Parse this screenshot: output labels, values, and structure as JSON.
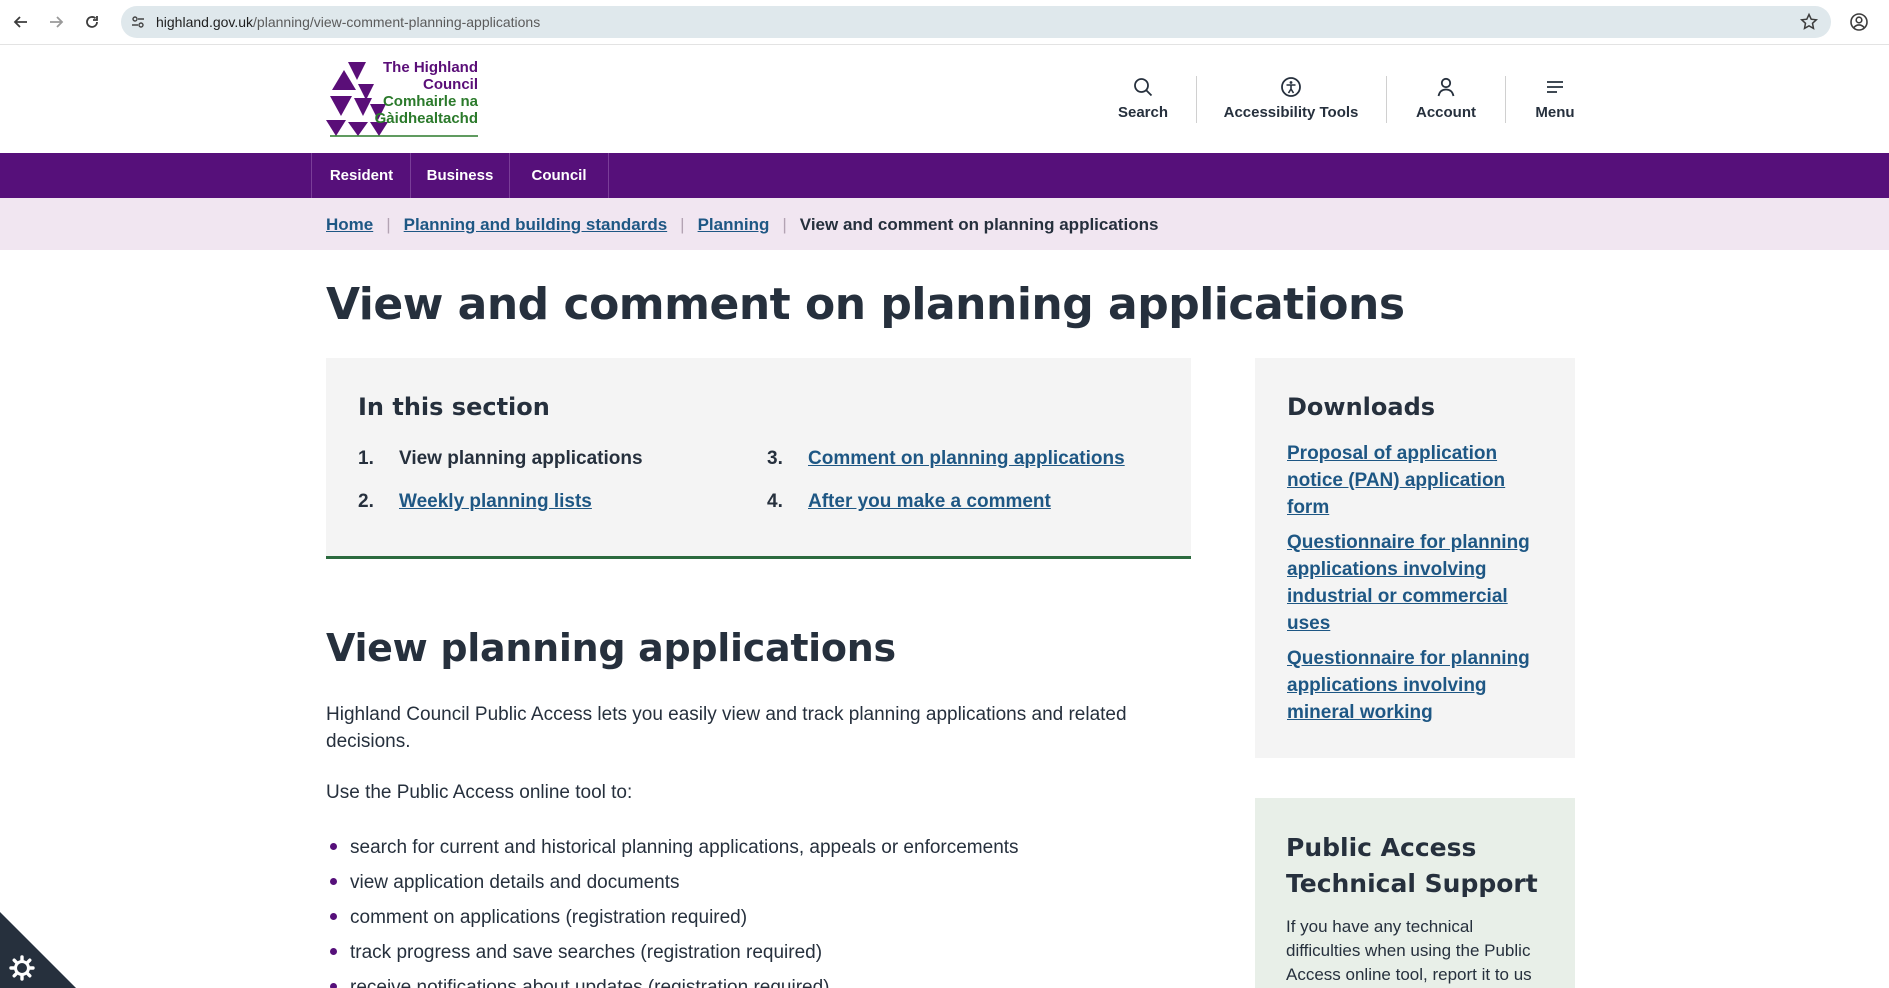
{
  "browser": {
    "url_host": "highland.gov.uk",
    "url_path": "/planning/view-comment-planning-applications"
  },
  "logo": {
    "line1": "The Highland",
    "line2": "Council",
    "line3": "Comhairle na",
    "line4": "Gàidhealtachd",
    "purple": "#5a0e78",
    "green": "#2b7a2b"
  },
  "header_tools": {
    "search": "Search",
    "accessibility": "Accessibility Tools",
    "account": "Account",
    "menu": "Menu"
  },
  "nav": {
    "resident": "Resident",
    "business": "Business",
    "council": "Council",
    "color": "#56107a"
  },
  "breadcrumb": {
    "home": "Home",
    "planning_building": "Planning and building standards",
    "planning": "Planning",
    "current": "View and comment on planning applications"
  },
  "page": {
    "title": "View and comment on planning applications"
  },
  "in_section": {
    "heading": "In this section",
    "items": [
      {
        "num": "1.",
        "label": "View planning applications"
      },
      {
        "num": "2.",
        "label": "Weekly planning lists"
      },
      {
        "num": "3.",
        "label": "Comment on planning applications"
      },
      {
        "num": "4.",
        "label": "After you make a comment"
      }
    ]
  },
  "view_section": {
    "heading": "View planning applications",
    "intro": "Highland Council Public Access lets you easily view and track planning applications and related decisions.",
    "use_text": "Use the Public Access online tool to:",
    "bullets": [
      "search for current and historical planning applications, appeals or enforcements",
      "view application details and documents",
      "comment on applications (registration required)",
      "track progress and save searches (registration required)",
      "receive notifications about updates (registration required)"
    ]
  },
  "downloads": {
    "heading": "Downloads",
    "links": [
      "Proposal of application notice (PAN) application form",
      "Questionnaire for planning applications involving industrial or commercial uses",
      "Questionnaire for planning applications involving mineral working"
    ]
  },
  "support": {
    "heading": "Public Access Technical Support",
    "text": "If you have any technical difficulties when using the Public Access online tool, report it to us"
  }
}
